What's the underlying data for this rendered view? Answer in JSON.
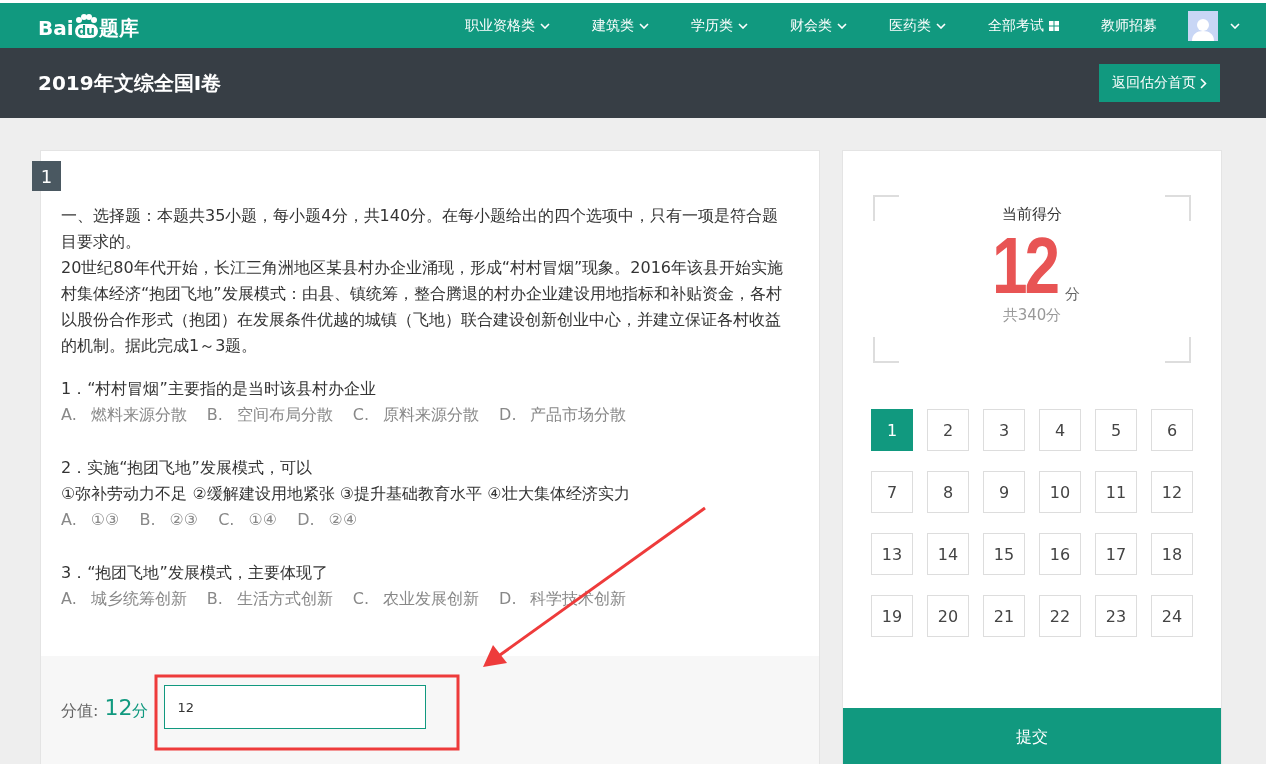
{
  "logo": {
    "left": "Bai",
    "paw": "du",
    "right": "题库"
  },
  "nav": [
    {
      "label": "职业资格类",
      "kind": "dropdown"
    },
    {
      "label": "建筑类",
      "kind": "dropdown"
    },
    {
      "label": "学历类",
      "kind": "dropdown"
    },
    {
      "label": "财会类",
      "kind": "dropdown"
    },
    {
      "label": "医药类",
      "kind": "dropdown"
    },
    {
      "label": "全部考试",
      "kind": "grid"
    },
    {
      "label": "教师招募",
      "kind": "plain"
    }
  ],
  "header": {
    "title": "2019年文综全国I卷",
    "back_button": "返回估分首页"
  },
  "question": {
    "number": "1",
    "paragraphs": [
      "一、选择题：本题共35小题，每小题4分，共140分。在每小题给出的四个选项中，只有一项是符合题目要求的。",
      "20世纪80年代开始，长江三角洲地区某县村办企业涌现，形成“村村冒烟”现象。2016年该县开始实施村集体经济“抱团飞地”发展模式：由县、镇统筹，整合腾退的村办企业建设用地指标和补贴资金，各村以股份合作形式（抱团）在发展条件优越的城镇（飞地）联合建设创新创业中心，并建立保证各村收益的机制。据此完成1～3题。"
    ],
    "items": [
      {
        "stem": "1．“村村冒烟”主要指的是当时该县村办企业",
        "options": [
          {
            "letter": "A.",
            "text": "燃料来源分散"
          },
          {
            "letter": "B.",
            "text": "空间布局分散"
          },
          {
            "letter": "C.",
            "text": "原料来源分散"
          },
          {
            "letter": "D.",
            "text": "产品市场分散"
          }
        ]
      },
      {
        "stem": "2．实施“抱团飞地”发展模式，可以",
        "statements": "①弥补劳动力不足 ②缓解建设用地紧张 ③提升基础教育水平 ④壮大集体经济实力",
        "options": [
          {
            "letter": "A.",
            "text": "①③"
          },
          {
            "letter": "B.",
            "text": "②③"
          },
          {
            "letter": "C.",
            "text": "①④"
          },
          {
            "letter": "D.",
            "text": "②④"
          }
        ]
      },
      {
        "stem": "3．“抱团飞地”发展模式，主要体现了",
        "options": [
          {
            "letter": "A.",
            "text": "城乡统筹创新"
          },
          {
            "letter": "B.",
            "text": "生活方式创新"
          },
          {
            "letter": "C.",
            "text": "农业发展创新"
          },
          {
            "letter": "D.",
            "text": "科学技术创新"
          }
        ]
      }
    ],
    "score_label": "分值:",
    "score_value": "12",
    "score_unit": "分",
    "score_input": "12"
  },
  "summary": {
    "label": "当前得分",
    "score": "12",
    "unit": "分",
    "total": "共340分",
    "numbers": [
      {
        "label": "1",
        "selected": true
      },
      {
        "label": "2",
        "selected": false
      },
      {
        "label": "3",
        "selected": false
      },
      {
        "label": "4",
        "selected": false
      },
      {
        "label": "5",
        "selected": false
      },
      {
        "label": "6",
        "selected": false
      },
      {
        "label": "7",
        "selected": false
      },
      {
        "label": "8",
        "selected": false
      },
      {
        "label": "9",
        "selected": false
      },
      {
        "label": "10",
        "selected": false
      },
      {
        "label": "11",
        "selected": false
      },
      {
        "label": "12",
        "selected": false
      },
      {
        "label": "13",
        "selected": false
      },
      {
        "label": "14",
        "selected": false
      },
      {
        "label": "15",
        "selected": false
      },
      {
        "label": "16",
        "selected": false
      },
      {
        "label": "17",
        "selected": false
      },
      {
        "label": "18",
        "selected": false
      },
      {
        "label": "19",
        "selected": false
      },
      {
        "label": "20",
        "selected": false
      },
      {
        "label": "21",
        "selected": false
      },
      {
        "label": "22",
        "selected": false
      },
      {
        "label": "23",
        "selected": false
      },
      {
        "label": "24",
        "selected": false
      }
    ],
    "submit": "提交"
  }
}
